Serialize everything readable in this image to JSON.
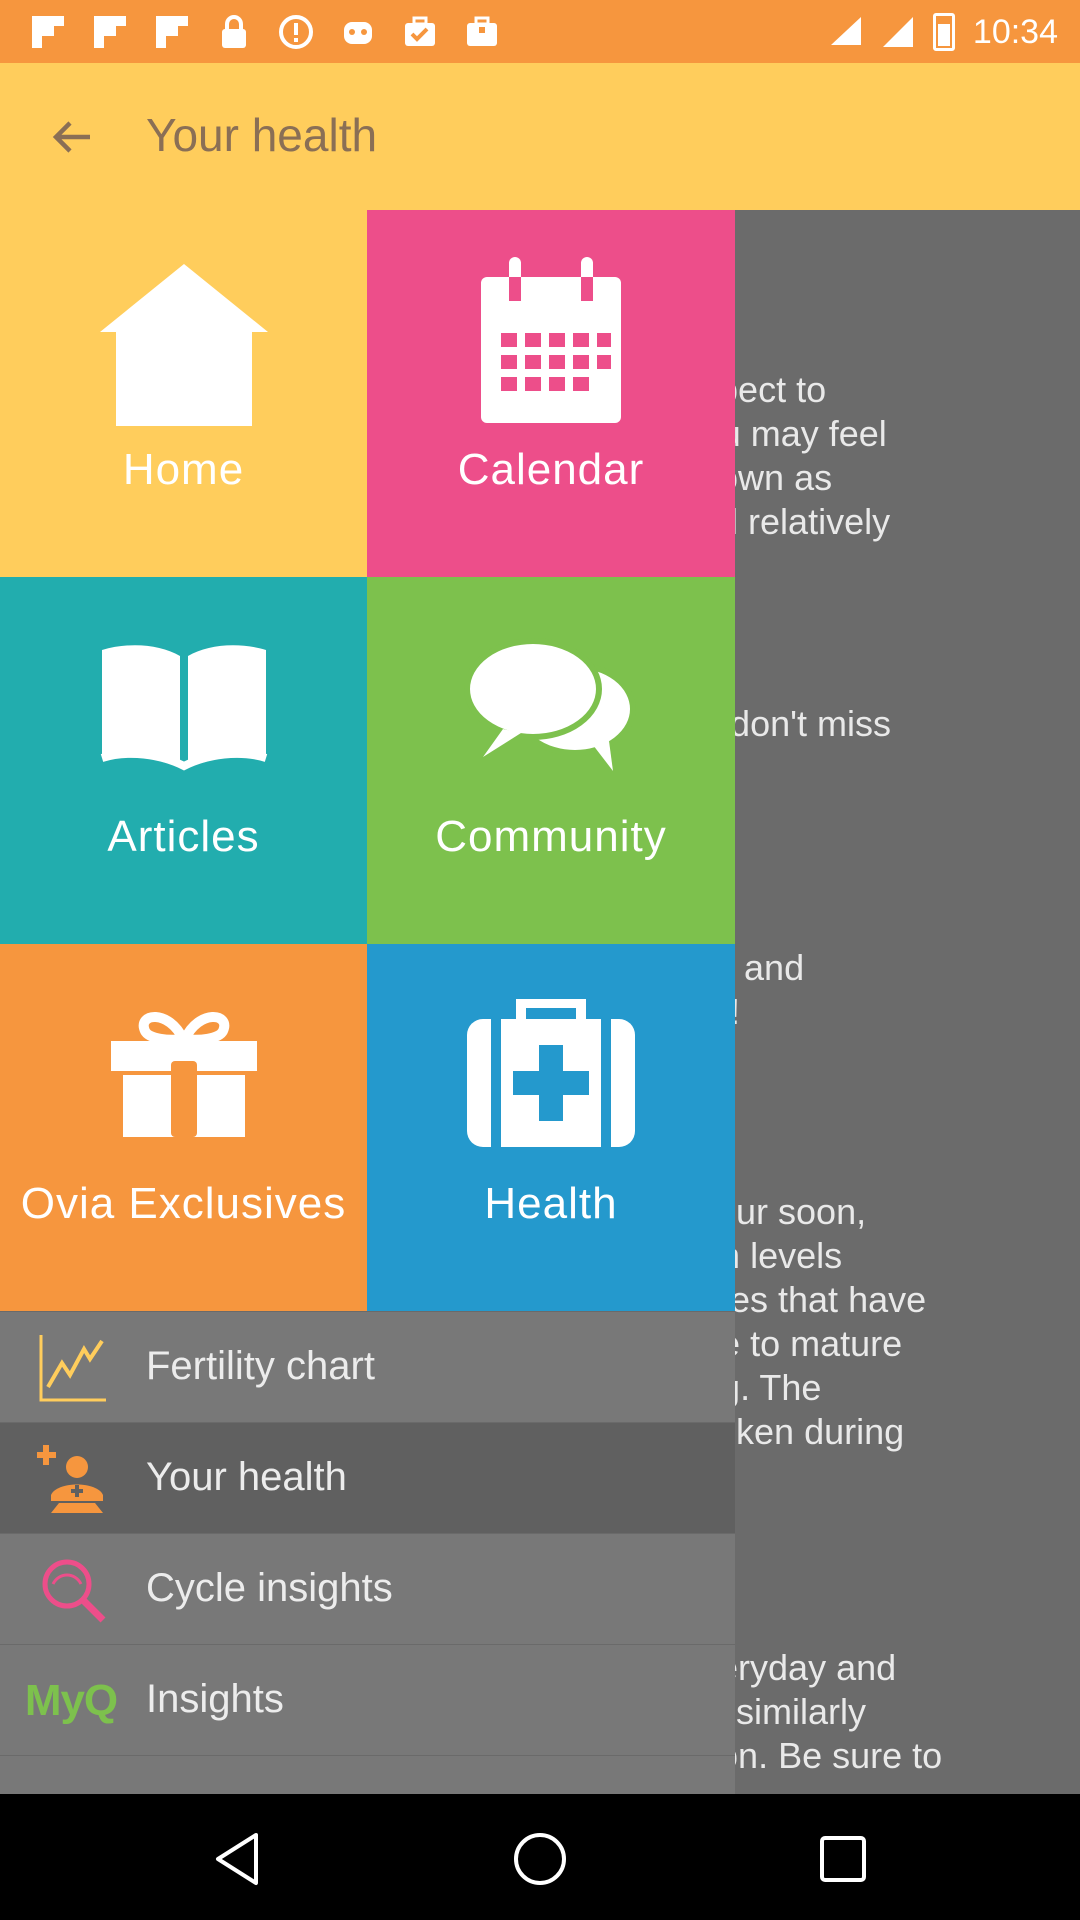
{
  "status_bar": {
    "time": "10:34",
    "notification_icons": [
      "flipboard-icon",
      "flipboard-icon",
      "flipboard-icon",
      "lock-icon",
      "alert-icon",
      "ovia-icon",
      "briefcase-check-icon",
      "briefcase-icon"
    ]
  },
  "app_bar": {
    "title": "Your health",
    "back_icon": "back-arrow-icon"
  },
  "article": {
    "paragraphs": [
      "expect to\nYou may feel\nknown as\nfeel relatively\nex.",
      "ou don't miss",
      "ow, and\neat!",
      "occur soon,\ngen levels\nllicles that have\nnue to mature\negg. The\nthicken during",
      "gly\neveryday and\nwn similarly\nption. Be sure to"
    ]
  },
  "tiles": [
    {
      "label": "Home",
      "icon": "home-icon",
      "color": "#ffcd5c"
    },
    {
      "label": "Calendar",
      "icon": "calendar-icon",
      "color": "#ed4e8a"
    },
    {
      "label": "Articles",
      "icon": "book-icon",
      "color": "#22adae"
    },
    {
      "label": "Community",
      "icon": "chat-bubbles-icon",
      "color": "#7dc14d"
    },
    {
      "label": "Ovia Exclusives",
      "icon": "gift-icon",
      "color": "#f6963e"
    },
    {
      "label": "Health",
      "icon": "medical-kit-icon",
      "color": "#2499cd"
    }
  ],
  "menu": [
    {
      "label": "Fertility chart",
      "icon": "chart-icon",
      "active": false
    },
    {
      "label": "Your health",
      "icon": "person-health-icon",
      "active": true
    },
    {
      "label": "Cycle insights",
      "icon": "search-cycle-icon",
      "active": false
    },
    {
      "label": "Insights",
      "icon_text": "MyQ",
      "active": false
    }
  ],
  "nav_bar": [
    "back-triangle-icon",
    "home-circle-icon",
    "recents-square-icon"
  ]
}
